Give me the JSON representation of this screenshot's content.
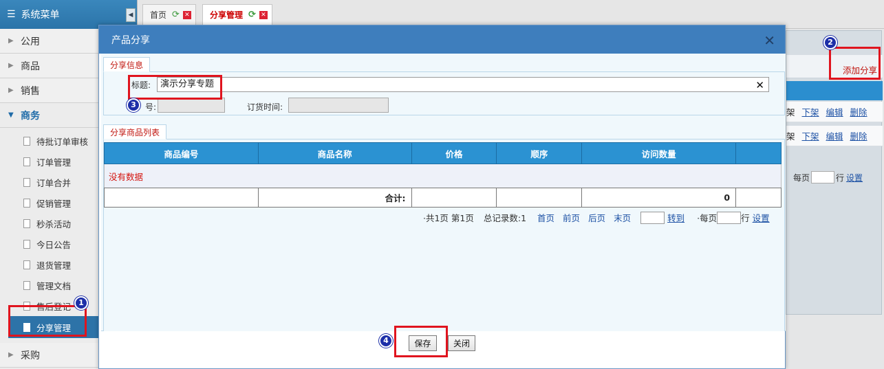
{
  "sidebar": {
    "header": "系统菜单",
    "categories": [
      "公用",
      "商品",
      "销售",
      "商务",
      "采购"
    ],
    "items": [
      "待批订单审核",
      "订单管理",
      "订单合并",
      "促销管理",
      "秒杀活动",
      "今日公告",
      "退货管理",
      "管理文档",
      "售后登记",
      "分享管理"
    ]
  },
  "tabs": [
    {
      "label": "首页"
    },
    {
      "label": "分享管理"
    }
  ],
  "background": {
    "add_label": "添加分享",
    "rows": [
      {
        "partial": "架",
        "offshelf": "下架",
        "edit": "编辑",
        "delete": "删除"
      },
      {
        "partial": "架",
        "offshelf": "下架",
        "edit": "编辑",
        "delete": "删除"
      }
    ],
    "pager": {
      "per_page": "每页",
      "rows_unit": "行",
      "settings": "设置"
    }
  },
  "dialog": {
    "title": "产品分享",
    "section_info": "分享信息",
    "title_label": "标题:",
    "title_value": "演示分享专题",
    "code_label": "号:",
    "order_time_label": "订货时间:",
    "section_goods": "分享商品列表",
    "columns": [
      "商品编号",
      "商品名称",
      "价格",
      "顺序",
      "访问数量"
    ],
    "no_data": "没有数据",
    "total_label": "合计:",
    "total_visits": "0",
    "pager": {
      "summary": "·共1页 第1页",
      "records": "总记录数:1",
      "first": "首页",
      "prev": "前页",
      "next": "后页",
      "last": "末页",
      "goto": "转到",
      "per_page": "·每页",
      "rows_unit": "行",
      "settings": "设置"
    },
    "save": "保存",
    "close": "关闭"
  },
  "annotations": [
    "1",
    "2",
    "3",
    "4"
  ],
  "colors": {
    "accent": "#3e7ebd",
    "annotation_red": "#e0141e",
    "badge_blue": "#1d2fa8",
    "link_red": "#c0160f"
  }
}
